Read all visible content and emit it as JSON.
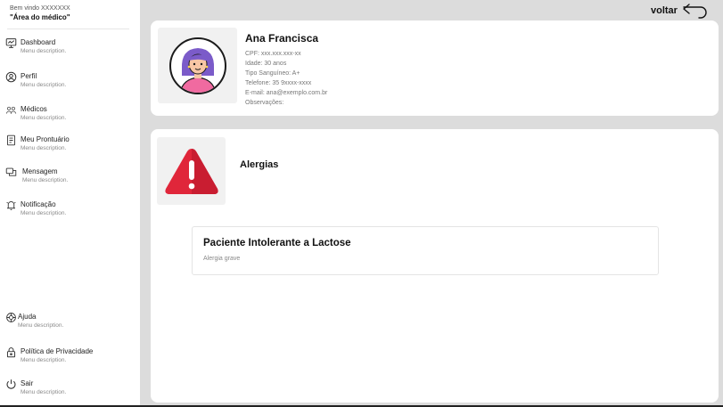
{
  "sidebar": {
    "welcome": "Bem vindo XXXXXXX",
    "area": "\"Área do médico\"",
    "items": [
      {
        "label": "Dashboard",
        "desc": "Menu description.",
        "icon": "dashboard-icon"
      },
      {
        "label": "Perfil",
        "desc": "Menu description.",
        "icon": "user-icon"
      },
      {
        "label": "Médicos",
        "desc": "Menu description.",
        "icon": "doctors-icon"
      },
      {
        "label": "Meu Prontuário",
        "desc": "Menu description.",
        "icon": "medical-record-icon"
      },
      {
        "label": "Mensagem",
        "desc": "Menu description.",
        "icon": "message-icon"
      },
      {
        "label": "Notificação",
        "desc": "Menu description.",
        "icon": "bell-icon"
      },
      {
        "label": "Ajuda",
        "desc": "Menu description.",
        "icon": "help-icon"
      },
      {
        "label": "Política de Privacidade",
        "desc": "Menu description.",
        "icon": "lock-icon"
      },
      {
        "label": "Sair",
        "desc": "Menu description.",
        "icon": "power-icon"
      }
    ]
  },
  "header": {
    "back_label": "voltar"
  },
  "patient": {
    "name": "Ana Francisca",
    "cpf": "CPF: xxx.xxx.xxx-xx",
    "age": "Idade: 30 anos",
    "blood": "Tipo Sanguíneo: A+",
    "phone": "Telefone: 35 9xxxx-xxxx",
    "email": "E-mail: ana@exemplo.com.br",
    "notes": "Observações:"
  },
  "allergies": {
    "title": "Alergias",
    "items": [
      {
        "name": "Paciente Intolerante a Lactose",
        "level": "Alergia grave"
      }
    ]
  },
  "colors": {
    "background": "#dcdcdc",
    "card": "#ffffff",
    "warning_red": "#e0263a",
    "avatar_pink": "#f06aa0",
    "avatar_hair": "#7b5bc9"
  }
}
